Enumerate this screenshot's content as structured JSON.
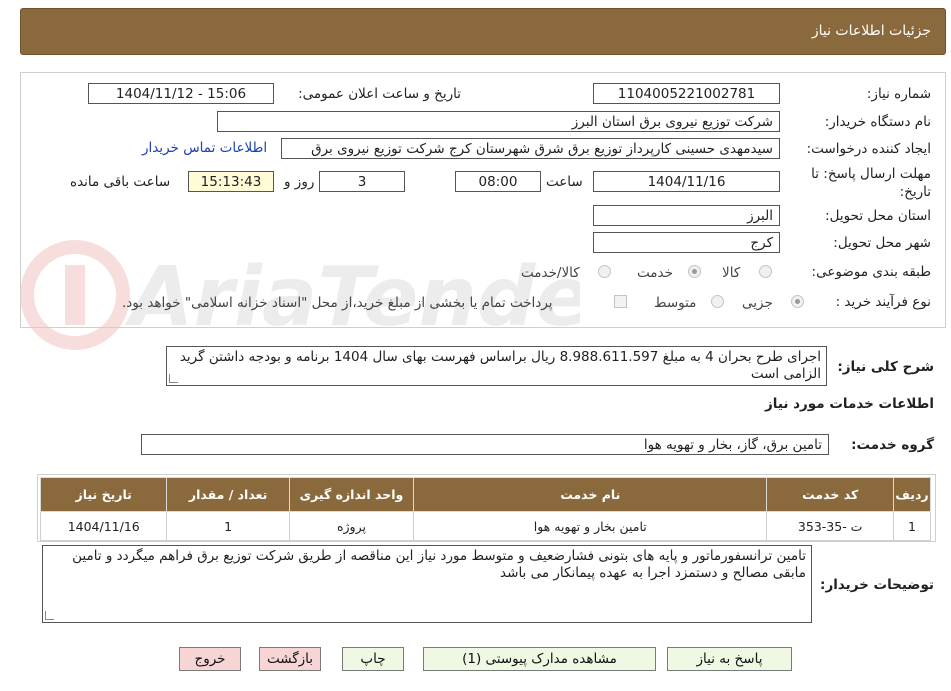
{
  "header": {
    "title": "جزئیات اطلاعات نیاز"
  },
  "form": {
    "need_number": {
      "label": "شماره نیاز:",
      "value": "1104005221002781"
    },
    "announce": {
      "label": "تاریخ و ساعت اعلان عمومی:",
      "value": "1404/11/12 - 15:06"
    },
    "buyer_org": {
      "label": "نام دستگاه خریدار:",
      "value": "شرکت توزیع نیروی برق استان البرز"
    },
    "requester": {
      "label": "ایجاد کننده درخواست:",
      "value": "سیدمهدی حسینی کارپرداز توزیع برق شرق شهرستان کرج شرکت توزیع نیروی برق"
    },
    "contact_link": "اطلاعات تماس خریدار",
    "deadline": {
      "label_line1": "مهلت ارسال پاسخ: تا",
      "label_line2": "تاریخ:",
      "date": "1404/11/16",
      "time_label": "ساعت",
      "time": "08:00",
      "days": "3",
      "days_label": "روز و",
      "remaining": "15:13:43",
      "remaining_label": "ساعت باقی مانده"
    },
    "province": {
      "label": "استان محل تحویل:",
      "value": "البرز"
    },
    "city": {
      "label": "شهر محل تحویل:",
      "value": "کرج"
    },
    "category": {
      "label": "طبقه بندی موضوعی:",
      "options": [
        "کالا",
        "خدمت",
        "کالا/خدمت"
      ],
      "selected": "خدمت"
    },
    "process": {
      "label": "نوع فرآیند خرید :",
      "options": [
        "جزیی",
        "متوسط"
      ],
      "selected": "جزیی",
      "payment_note": "پرداخت تمام یا بخشی از مبلغ خرید،از محل \"اسناد خزانه اسلامی\" خواهد بود."
    }
  },
  "watermark": {
    "text": "AriaTender.neT"
  },
  "description": {
    "label": "شرح کلی نیاز:",
    "value": "اجرای طرح بحران 4 به مبلغ 8.988.611.597 ریال براساس فهرست بهای سال 1404 برنامه و بودجه داشتن گرید الزامی است"
  },
  "services_title": "اطلاعات خدمات مورد نیاز",
  "service_group": {
    "label": "گروه خدمت:",
    "value": "تامین برق، گاز، بخار و تهویه هوا"
  },
  "table": {
    "headers": [
      "ردیف",
      "کد خدمت",
      "نام خدمت",
      "واحد اندازه گیری",
      "تعداد / مقدار",
      "تاریخ نیاز"
    ],
    "rows": [
      [
        "1",
        "ت -35-353",
        "تامین بخار و تهویه هوا",
        "پروژه",
        "1",
        "1404/11/16"
      ]
    ]
  },
  "buyer_notes": {
    "label": "توضیحات خریدار:",
    "value": "تامین ترانسفورماتور و پایه های بتونی فشارضعیف و متوسط مورد نیاز این مناقصه از طریق شرکت توزیع برق فراهم میگردد و تامین مابقی مصالح و دستمزد اجرا به عهده پیمانکار می باشد"
  },
  "buttons": {
    "respond": "پاسخ به نیاز",
    "attachments": "مشاهده مدارک پیوستی (1)",
    "print": "چاپ",
    "back": "بازگشت",
    "exit": "خروج"
  }
}
